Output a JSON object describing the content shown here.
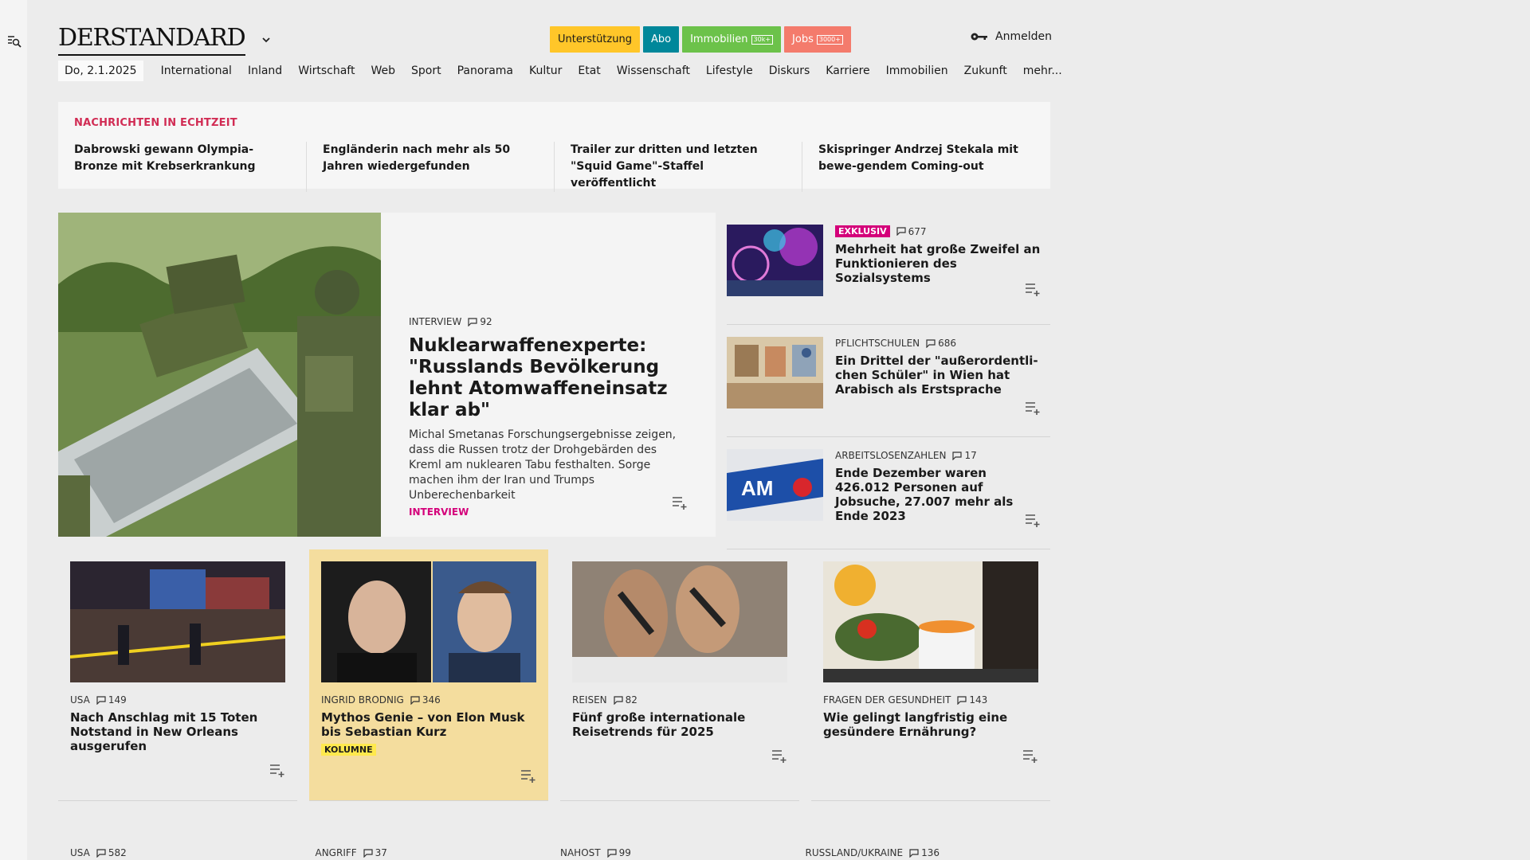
{
  "brand": {
    "logo": "DERSTANDARD"
  },
  "promo": [
    {
      "label": "Unterstützung"
    },
    {
      "label": "Abo"
    },
    {
      "label": "Immobilien",
      "count": "30k+"
    },
    {
      "label": "Jobs",
      "count": "3000+"
    }
  ],
  "login_label": "Anmelden",
  "nav": {
    "date": "Do, 2.1.2025",
    "items": [
      "International",
      "Inland",
      "Wirtschaft",
      "Web",
      "Sport",
      "Panorama",
      "Kultur",
      "Etat",
      "Wissenschaft",
      "Lifestyle",
      "Diskurs",
      "Karriere",
      "Immobilien",
      "Zukunft",
      "mehr..."
    ]
  },
  "ticker": {
    "label": "NACHRICHTEN IN ECHTZEIT",
    "items": [
      "Dabrowski gewann Olympia-Bronze mit Krebserkrankung",
      "Engländerin nach mehr als 50 Jahren wiedergefunden",
      "Trailer zur dritten und letzten \"Squid Game\"-Staffel veröffentlicht",
      "Skispringer Andrzej Stekala mit bewe-gendem Coming-out"
    ]
  },
  "lead": {
    "kicker": "INTERVIEW",
    "comments": "92",
    "title": "Nuklearwaffenexperte: \"Russlands Bevölkerung lehnt Atomwaffeneinsatz klar ab\"",
    "lead": "Michal Smetanas Forschungsergebnisse zeigen, dass die Russen trotz der Drohgebärden des Kreml am nuklearen Tabu festhalten. Sorge machen ihm der Iran und Trumps Unberechenbarkeit",
    "tag": "INTERVIEW"
  },
  "side": [
    {
      "badge": "EXKLUSIV",
      "kicker": "",
      "comments": "677",
      "title": "Mehrheit hat große Zweifel an Funktionieren des Sozialsystems"
    },
    {
      "badge": "",
      "kicker": "PFLICHTSCHULEN",
      "comments": "686",
      "title": "Ein Drittel der \"außerordentli-chen Schüler\" in Wien hat Arabisch als Erstsprache"
    },
    {
      "badge": "",
      "kicker": "ARBEITSLOSENZAHLEN",
      "comments": "17",
      "title": "Ende Dezember waren 426.012 Personen auf Jobsuche, 27.007 mehr als Ende 2023"
    }
  ],
  "teasers": [
    {
      "kicker": "USA",
      "comments": "149",
      "title": "Nach Anschlag mit 15 Toten Notstand in New Orleans ausgerufen",
      "tag": ""
    },
    {
      "kicker": "INGRID BRODNIG",
      "comments": "346",
      "title": "Mythos Genie – von Elon Musk bis Sebastian Kurz",
      "tag": "KOLUMNE"
    },
    {
      "kicker": "REISEN",
      "comments": "82",
      "title": "Fünf große internationale Reisetrends für 2025",
      "tag": ""
    },
    {
      "kicker": "FRAGEN DER GESUNDHEIT",
      "comments": "143",
      "title": "Wie gelingt langfristig eine gesündere Ernährung?",
      "tag": ""
    }
  ],
  "bottom": [
    {
      "kicker": "USA",
      "comments": "582"
    },
    {
      "kicker": "ANGRIFF",
      "comments": "37"
    },
    {
      "kicker": "NAHOST",
      "comments": "99"
    },
    {
      "kicker": "RUSSLAND/UKRAINE",
      "comments": "136"
    }
  ],
  "side_images": [
    "ferris-wheel-fireworks-photo",
    "classroom-photo",
    "ams-logo-photo"
  ],
  "teaser_images": [
    "new-orleans-police-photo",
    "musk-kurz-portrait-photo",
    "sandals-feet-photo",
    "cooking-pot-photo"
  ],
  "lead_image": "soldier-missile-photo",
  "colors": {
    "pink": "#d4007a",
    "ticker_red": "#d12c54",
    "column_yellow": "#f4dd9e"
  }
}
